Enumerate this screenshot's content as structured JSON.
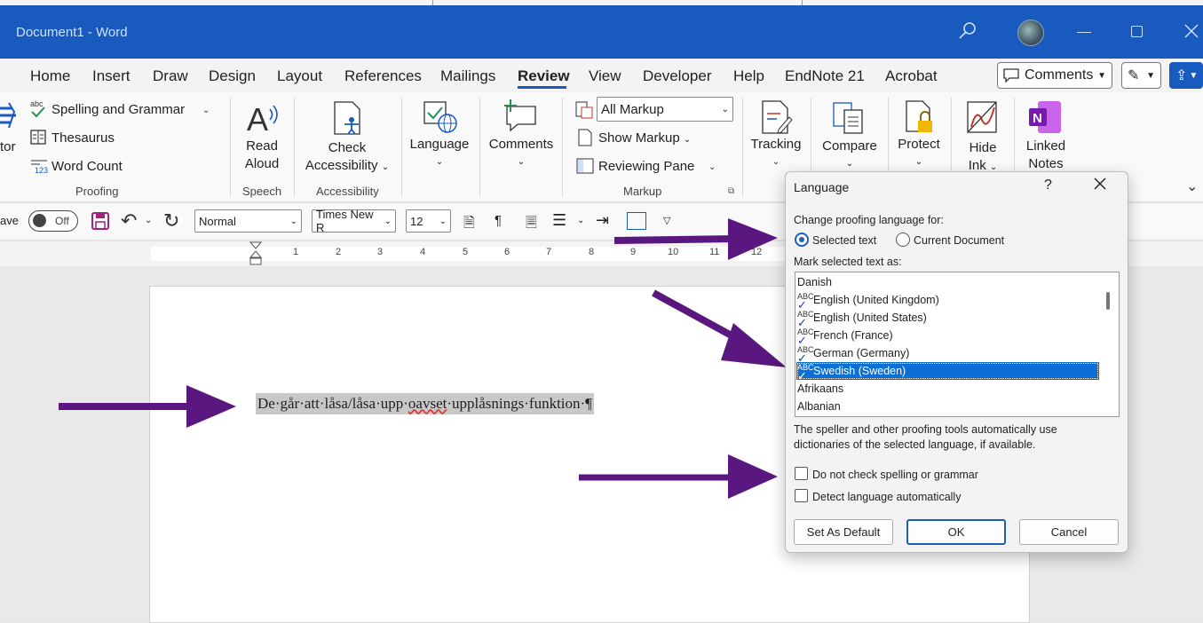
{
  "window": {
    "title": "Document1  -  Word"
  },
  "tabs": [
    "Home",
    "Insert",
    "Draw",
    "Design",
    "Layout",
    "References",
    "Mailings",
    "Review",
    "View",
    "Developer",
    "Help",
    "EndNote 21",
    "Acrobat"
  ],
  "active_tab": "Review",
  "top_right": {
    "comments_label": "Comments"
  },
  "ribbon": {
    "proofing": {
      "partial_label": "tor",
      "spelling": "Spelling and Grammar",
      "thesaurus": "Thesaurus",
      "word_count": "Word Count",
      "group": "Proofing"
    },
    "speech": {
      "read_aloud_1": "Read",
      "read_aloud_2": "Aloud",
      "group": "Speech"
    },
    "accessibility": {
      "check_1": "Check",
      "check_2": "Accessibility",
      "group": "Accessibility"
    },
    "language": {
      "label": "Language"
    },
    "comments": {
      "label": "Comments"
    },
    "markup": {
      "all_markup": "All Markup",
      "show_markup": "Show Markup",
      "reviewing_pane": "Reviewing Pane",
      "group": "Markup"
    },
    "tracking": {
      "label": "Tracking"
    },
    "compare": {
      "label": "Compare"
    },
    "protect": {
      "label": "Protect"
    },
    "hide_ink": {
      "label_1": "Hide",
      "label_2": "Ink"
    },
    "linked_notes": {
      "label_1": "Linked",
      "label_2": "Notes"
    }
  },
  "format_bar": {
    "autosave_partial": "ave",
    "toggle": "Off",
    "style": "Normal",
    "font": "Times New R",
    "size": "12"
  },
  "ruler": {
    "numbers": [
      "1",
      "2",
      "3",
      "4",
      "5",
      "6",
      "7",
      "8",
      "9",
      "10",
      "11",
      "12"
    ]
  },
  "document": {
    "text_before": "De·går·att·låsa/låsa·upp·",
    "text_misspelled": "oavset",
    "text_after": "·upplåsnings·funktion·¶"
  },
  "dialog": {
    "title": "Language",
    "help": "?",
    "change_label": "Change proofing language for:",
    "radio_selected": "Selected text",
    "radio_document": "Current Document",
    "mark_label": "Mark selected text as:",
    "languages": [
      {
        "name": "Danish",
        "check": false
      },
      {
        "name": "English (United Kingdom)",
        "check": true
      },
      {
        "name": "English (United States)",
        "check": true
      },
      {
        "name": "French (France)",
        "check": true
      },
      {
        "name": "German (Germany)",
        "check": true
      },
      {
        "name": "Swedish (Sweden)",
        "check": true
      },
      {
        "name": "Afrikaans",
        "check": false
      },
      {
        "name": "Albanian",
        "check": false
      }
    ],
    "selected_language": "Swedish (Sweden)",
    "check_abc": "ABC",
    "info_line1": "The speller and other proofing tools automatically use",
    "info_line2": "dictionaries of the selected language, if available.",
    "no_check": "Do not check spelling or grammar",
    "detect": "Detect language automatically",
    "btn_default": "Set As Default",
    "btn_ok": "OK",
    "btn_cancel": "Cancel"
  },
  "colors": {
    "title_bar": "#185abd",
    "arrow": "#5b1780",
    "selection": "#0b6fd6"
  }
}
